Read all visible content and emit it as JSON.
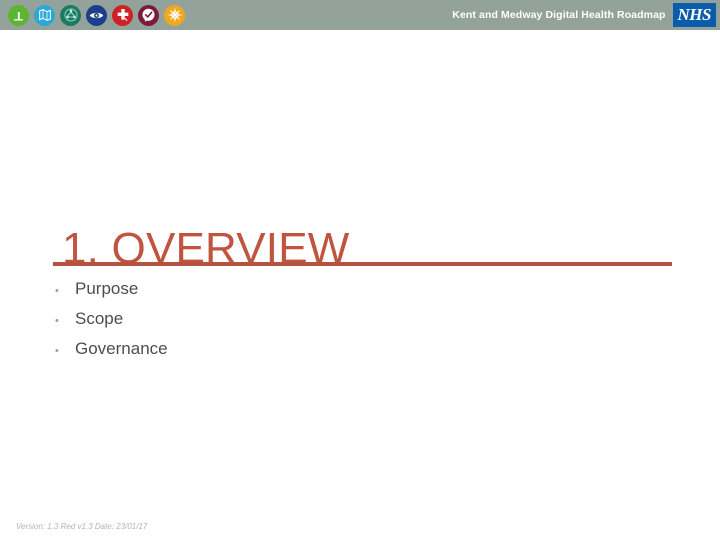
{
  "header": {
    "title": "Kent and Medway Digital Health Roadmap",
    "logo_text": "NHS",
    "bar_color": "#93a39b",
    "logo_bg": "#0b5cab",
    "icons": [
      {
        "name": "green-circle-icon",
        "color": "#5cb531"
      },
      {
        "name": "cyan-map-icon",
        "color": "#2aa8d8"
      },
      {
        "name": "teal-network-icon",
        "color": "#1d7a62"
      },
      {
        "name": "navy-eye-icon",
        "color": "#1b3f8b"
      },
      {
        "name": "red-medical-cross-icon",
        "color": "#cf2026"
      },
      {
        "name": "maroon-check-icon",
        "color": "#7b1a3a"
      },
      {
        "name": "gold-snowflake-icon",
        "color": "#f0a81e"
      }
    ]
  },
  "slide": {
    "title": "1. OVERVIEW",
    "title_color": "#c0543f",
    "rule_color": "#b2543f",
    "bullet_marker": "•",
    "bullets": [
      {
        "label": "Purpose"
      },
      {
        "label": "Scope"
      },
      {
        "label": "Governance"
      }
    ]
  },
  "footer": {
    "version_text": "Version: 1.3 Red v1.3 Date: 23/01/17"
  }
}
